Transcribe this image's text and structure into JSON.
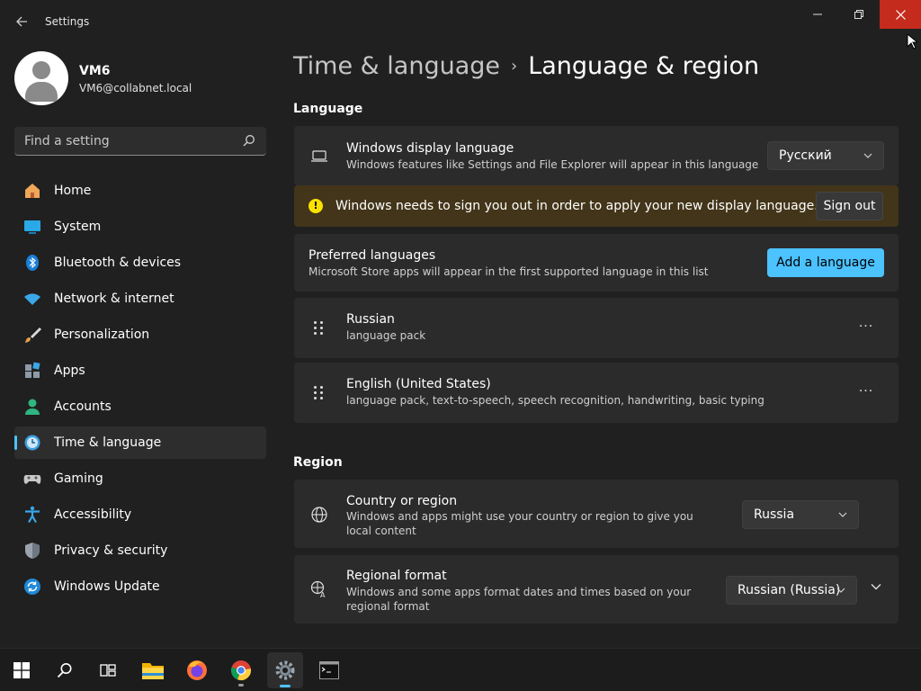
{
  "window": {
    "app_title": "Settings",
    "minimize_glyph": "—",
    "maximize_glyph": "❐",
    "close_glyph": "✕"
  },
  "profile": {
    "name": "VM6",
    "email": "VM6@collabnet.local"
  },
  "search": {
    "placeholder": "Find a setting"
  },
  "nav": {
    "items": [
      {
        "label": "Home",
        "icon": "home-icon"
      },
      {
        "label": "System",
        "icon": "system-icon"
      },
      {
        "label": "Bluetooth & devices",
        "icon": "bluetooth-icon"
      },
      {
        "label": "Network & internet",
        "icon": "wifi-icon"
      },
      {
        "label": "Personalization",
        "icon": "brush-icon"
      },
      {
        "label": "Apps",
        "icon": "apps-icon"
      },
      {
        "label": "Accounts",
        "icon": "accounts-icon"
      },
      {
        "label": "Time & language",
        "icon": "time-language-icon",
        "active": true
      },
      {
        "label": "Gaming",
        "icon": "gamepad-icon"
      },
      {
        "label": "Accessibility",
        "icon": "accessibility-icon"
      },
      {
        "label": "Privacy & security",
        "icon": "shield-icon"
      },
      {
        "label": "Windows Update",
        "icon": "update-icon"
      }
    ]
  },
  "breadcrumb": {
    "parent": "Time & language",
    "separator": "›",
    "current": "Language & region"
  },
  "language_section": {
    "title": "Language",
    "display_language": {
      "title": "Windows display language",
      "subtitle": "Windows features like Settings and File Explorer will appear in this language",
      "value": "Русский"
    },
    "warning": {
      "text": "Windows needs to sign you out in order to apply your new display language.",
      "button": "Sign out",
      "icon_glyph": "!"
    },
    "preferred": {
      "title": "Preferred languages",
      "subtitle": "Microsoft Store apps will appear in the first supported language in this list",
      "button": "Add a language"
    },
    "languages": [
      {
        "name": "Russian",
        "detail": "language pack"
      },
      {
        "name": "English (United States)",
        "detail": "language pack, text-to-speech, speech recognition, handwriting, basic typing"
      }
    ],
    "more_glyph": "···"
  },
  "region_section": {
    "title": "Region",
    "country": {
      "title": "Country or region",
      "subtitle": "Windows and apps might use your country or region to give you local content",
      "value": "Russia"
    },
    "format": {
      "title": "Regional format",
      "subtitle": "Windows and some apps format dates and times based on your regional format",
      "value": "Russian (Russia)"
    }
  },
  "taskbar": {
    "items": [
      "start",
      "search",
      "task-view",
      "file-explorer",
      "firefox",
      "chrome",
      "settings",
      "terminal"
    ]
  },
  "colors": {
    "accent": "#4cc2ff",
    "background": "#202020",
    "card": "#2b2b2b",
    "warning_bg": "#433519",
    "close_red": "#c42b1c"
  }
}
